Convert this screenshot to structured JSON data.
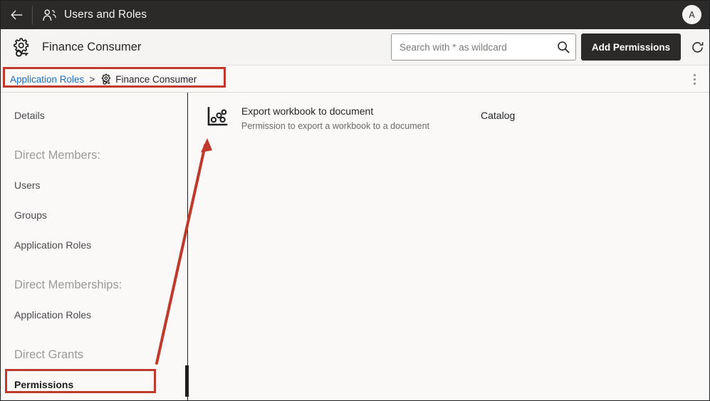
{
  "header": {
    "back_icon": "back-arrow-icon",
    "people_icon": "people-icon",
    "title": "Users and Roles",
    "avatar_initial": "A"
  },
  "toolbar": {
    "role_icon": "application-role-gear-key-icon",
    "role_title": "Finance Consumer",
    "search": {
      "placeholder": "Search with * as wildcard",
      "value": "",
      "icon": "search-icon"
    },
    "add_permissions_label": "Add Permissions",
    "refresh_icon": "refresh-icon"
  },
  "breadcrumb": {
    "parent_label": "Application Roles",
    "separator": ">",
    "current_icon": "application-role-gear-key-icon",
    "current_label": "Finance Consumer",
    "more_icon": "kebab-menu-icon"
  },
  "sidebar": {
    "items": [
      {
        "label": "Details",
        "type": "item",
        "selected": false
      },
      {
        "label": "Direct Members:",
        "type": "group"
      },
      {
        "label": "Users",
        "type": "item",
        "selected": false
      },
      {
        "label": "Groups",
        "type": "item",
        "selected": false
      },
      {
        "label": "Application Roles",
        "type": "item",
        "selected": false
      },
      {
        "label": "Direct Memberships:",
        "type": "group"
      },
      {
        "label": "Application Roles",
        "type": "item",
        "selected": false
      },
      {
        "label": "Direct Grants",
        "type": "group"
      },
      {
        "label": "Permissions",
        "type": "item",
        "selected": true
      }
    ]
  },
  "content": {
    "permissions": [
      {
        "icon": "scatter-plot-icon",
        "title": "Export workbook to document",
        "description": "Permission to export a workbook to a document",
        "scope": "Catalog"
      }
    ]
  },
  "annotations": {
    "highlight_color": "#c0392b",
    "boxes": [
      {
        "name": "breadcrumb-highlight"
      },
      {
        "name": "permissions-nav-highlight"
      }
    ],
    "arrow": {
      "name": "callout-arrow",
      "from": "permissions-nav",
      "to": "permission-list-row"
    }
  },
  "colors": {
    "header_bg": "#2b2a28",
    "toolbar_bg": "#f5f4f2",
    "page_bg": "#faf9f8",
    "link": "#1a6fc4",
    "accent_button": "#2b2a28"
  }
}
